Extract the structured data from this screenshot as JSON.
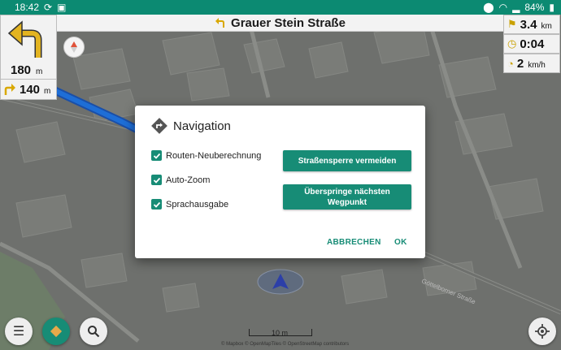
{
  "status": {
    "time": "18:42",
    "battery": "84%"
  },
  "street": {
    "name": "Grauer Stein Straße"
  },
  "turn": {
    "distance": "180",
    "unit": "m"
  },
  "next_turn": {
    "distance": "140",
    "unit": "m"
  },
  "info": {
    "distance": {
      "value": "3.4",
      "unit": "km"
    },
    "time": {
      "value": "0:04"
    },
    "speed": {
      "value": "2",
      "unit": "km/h"
    }
  },
  "map": {
    "street_label": "Göttelborner Straße",
    "scale": "10 m",
    "attribution": "© Mapbox © OpenMapTiles © OpenStreetMap contributors"
  },
  "dialog": {
    "title": "Navigation",
    "checkboxes": [
      "Routen-Neuberechnung",
      "Auto-Zoom",
      "Sprachausgabe"
    ],
    "buttons": {
      "avoid_roadblock": "Straßensperre vermeiden",
      "skip_waypoint_line1": "Überspringe nächsten",
      "skip_waypoint_line2": "Wegpunkt"
    },
    "cancel": "ABBRECHEN",
    "ok": "OK"
  },
  "colors": {
    "accent": "#178c76",
    "statusbar": "#0c8a72",
    "route": "#1a64c8"
  }
}
